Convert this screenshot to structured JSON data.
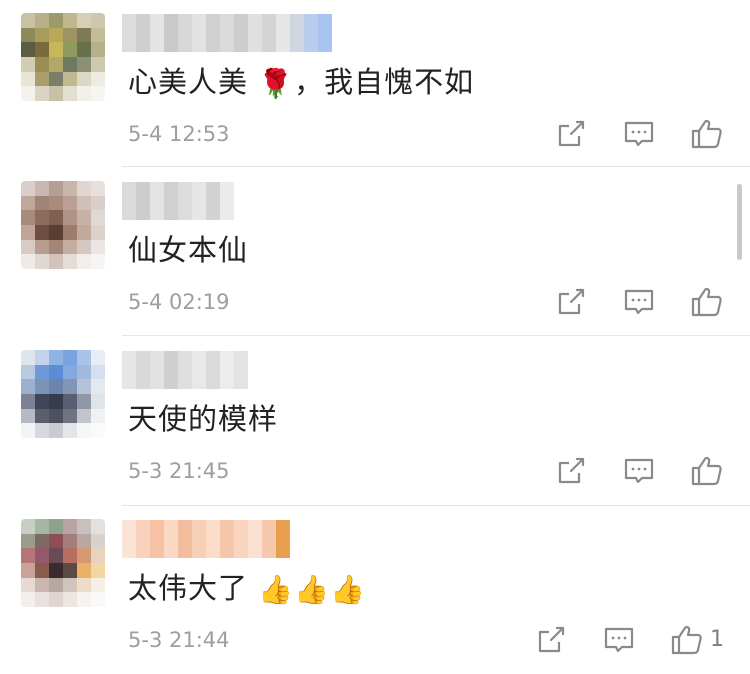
{
  "comments": [
    {
      "text": "心美人美",
      "emoji": "🌹",
      "text_after": "，我自愧不如",
      "time": "5-4 12:53",
      "like_count": ""
    },
    {
      "text": "仙女本仙",
      "emoji": "",
      "text_after": "",
      "time": "5-4 02:19",
      "like_count": ""
    },
    {
      "text": "天使的模样",
      "emoji": "",
      "text_after": "",
      "time": "5-3 21:45",
      "like_count": ""
    },
    {
      "text": "太伟大了",
      "emoji": "👍👍👍",
      "text_after": "",
      "time": "5-3 21:44",
      "like_count": "1"
    }
  ],
  "icons": {
    "share": "share-icon",
    "reply": "comment-icon",
    "like": "thumbs-up-icon"
  },
  "colors": {
    "text": "#222222",
    "meta": "#9e9e9e",
    "icon": "#8a8a8a",
    "separator": "#e7e7e7"
  }
}
